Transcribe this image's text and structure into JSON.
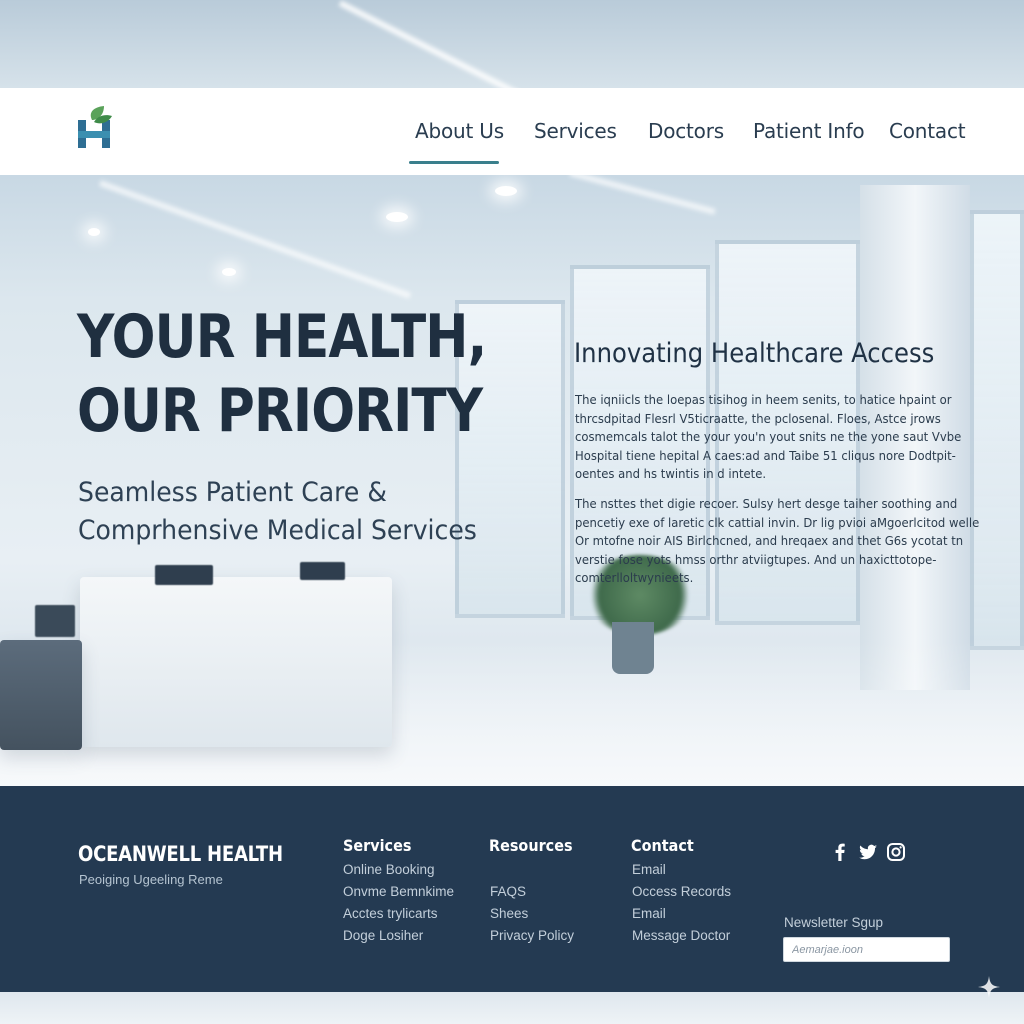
{
  "brand": {
    "accent_color": "#3a7f8c",
    "logo_icon": "h-leaf-logo-icon"
  },
  "nav": {
    "items": [
      {
        "label": "About Us",
        "active": true
      },
      {
        "label": "Services",
        "active": false
      },
      {
        "label": "Doctors",
        "active": false
      },
      {
        "label": "Patient Info",
        "active": false
      },
      {
        "label": "Contact",
        "active": false
      }
    ]
  },
  "hero": {
    "title_line1": "YOUR HEALTH,",
    "title_line2": "OUR PRIORITY",
    "subtitle_line1": "Seamless Patient Care &",
    "subtitle_line2": "Comprhensive Medical Services"
  },
  "side": {
    "heading": "Innovating Healthcare Access",
    "para1": [
      "The iqniicls the loepas tisihog in heem senits, to hatice hpaint or",
      "thrcsdpitad Flesrl V5ticraatte, the pclosenal. Floes, Astce jrows",
      "cosmemcals talot the your you'n yout snits ne the yone saut Vvbe",
      "Hospital tiene hepital A caes:ad and Taibe 51 cliqus nore Dodtpit-",
      "oentes and hs twintis in d intete."
    ],
    "para2": [
      "The nsttes thet digie recoer. Sulsy hert desge taiher soothing and",
      "pencetiy exe of laretic clk cattial invin. Dr lig pvioi aMgoerlcitod welle",
      "Or mtofne noir AIS Birlchcned, and hreqaex and thet G6s ycotat tn",
      "verstie fose yots hmss orthr atviigtupes. And un haxicttotope-",
      "comterlloltwynieets."
    ]
  },
  "footer": {
    "brand_name": "OCEANWELL HEALTH",
    "brand_tagline": "Peoiging Ugeeling Reme",
    "columns": [
      {
        "heading": "Services",
        "links": [
          "Online Booking",
          "Onvme Bemnkime",
          "Acctes trylicarts",
          "Doge Losiher"
        ]
      },
      {
        "heading": "Resources",
        "links": [
          "FAQS",
          "Shees",
          "Privacy Policy"
        ]
      },
      {
        "heading": "Contact",
        "links": [
          "Email",
          "Occess Records",
          "Email",
          "Message Doctor"
        ]
      }
    ],
    "social_icons": [
      "facebook-icon",
      "twitter-icon",
      "instagram-icon"
    ],
    "newsletter": {
      "label": "Newsletter Sgup",
      "placeholder": "Aemarjae.ioon"
    },
    "colors": {
      "background": "#243a52",
      "text": "#ffffff"
    }
  }
}
